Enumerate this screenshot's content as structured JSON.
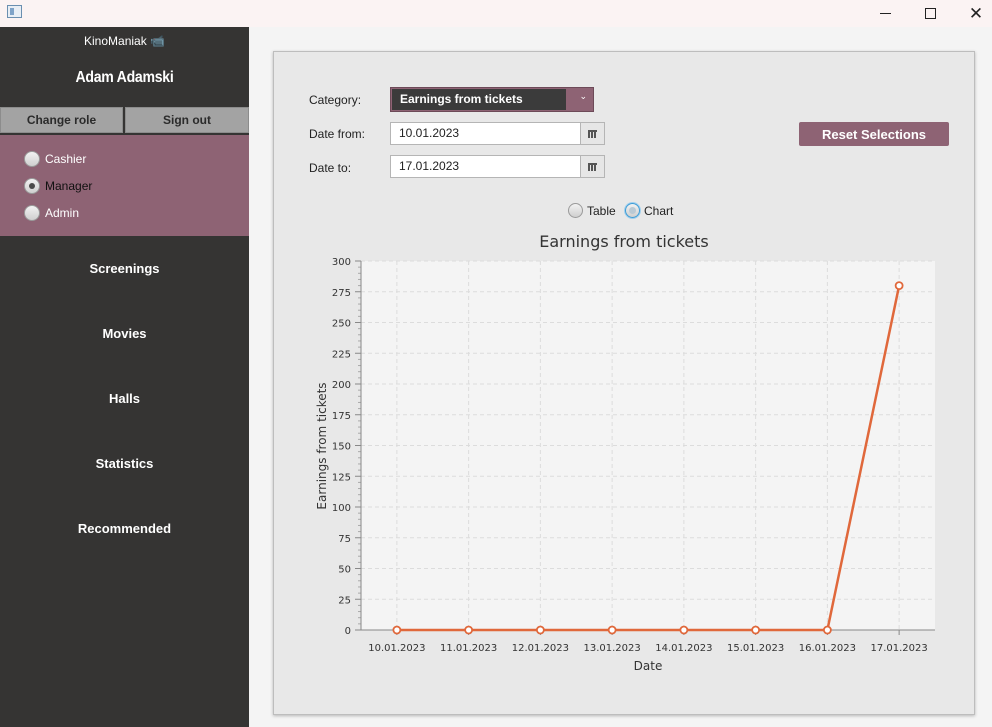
{
  "window": {
    "minimize_label": "",
    "maximize_label": "",
    "close_label": "✕"
  },
  "sidebar": {
    "brand": "KinoManiak 📹",
    "user_name": "Adam Adamski",
    "change_role": "Change role",
    "sign_out": "Sign out",
    "roles": [
      {
        "label": "Cashier",
        "selected": false
      },
      {
        "label": "Manager",
        "selected": true
      },
      {
        "label": "Admin",
        "selected": false
      }
    ],
    "nav": [
      "Screenings",
      "Movies",
      "Halls",
      "Statistics",
      "Recommended"
    ]
  },
  "form": {
    "category_label": "Category:",
    "category_value": "Earnings from tickets",
    "date_from_label": "Date from:",
    "date_from_value": "10.01.2023",
    "date_to_label": "Date to:",
    "date_to_value": "17.01.2023",
    "reset_label": "Reset Selections"
  },
  "view": {
    "table_label": "Table",
    "chart_label": "Chart",
    "selected": "Chart"
  },
  "colors": {
    "accent": "#8e6374",
    "sidebar_bg": "#353433",
    "series_line": "#e0683b"
  },
  "chart_data": {
    "type": "line",
    "title": "Earnings from tickets",
    "xlabel": "Date",
    "ylabel": "Earnings from tickets",
    "categories": [
      "10.01.2023",
      "11.01.2023",
      "12.01.2023",
      "13.01.2023",
      "14.01.2023",
      "15.01.2023",
      "16.01.2023",
      "17.01.2023"
    ],
    "values": [
      0,
      0,
      0,
      0,
      0,
      0,
      0,
      280
    ],
    "ylim": [
      0,
      300
    ],
    "y_major_ticks": [
      0,
      25,
      50,
      75,
      100,
      125,
      150,
      175,
      200,
      225,
      250,
      275,
      300
    ],
    "grid": true,
    "legend": "none"
  }
}
